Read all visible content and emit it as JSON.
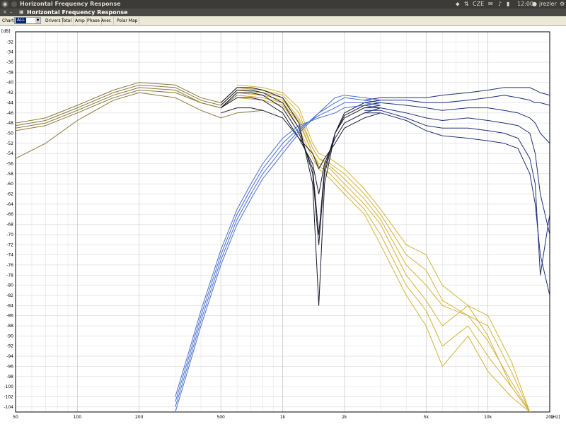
{
  "topbar": {
    "title": "Horizontal Frequency Response",
    "keyboard_layout": "CZE",
    "time": "12:00",
    "user": "jrezler"
  },
  "subbar": {
    "title": "Horizontal Frequency Response"
  },
  "toolbar": {
    "chart_label": "Chart",
    "chart_value": "ALL",
    "buttons": [
      "Drivers",
      "Total",
      "Amp",
      "Phase",
      "Aver.",
      "Polar Map"
    ]
  },
  "chart_data": {
    "type": "line",
    "ylabel": "[dB]",
    "xlabel": "[Hz]",
    "x_scale": "log",
    "xlim": [
      50,
      20000
    ],
    "ylim": [
      -105,
      -30
    ],
    "grid": true,
    "x_tick_labels": [
      {
        "value": 50,
        "label": "50"
      },
      {
        "value": 100,
        "label": "100"
      },
      {
        "value": 200,
        "label": "200"
      },
      {
        "value": 500,
        "label": "500"
      },
      {
        "value": 1000,
        "label": "1k"
      },
      {
        "value": 2000,
        "label": "2k"
      },
      {
        "value": 5000,
        "label": "5k"
      },
      {
        "value": 10000,
        "label": "10k"
      },
      {
        "value": 20000,
        "label": "20k"
      }
    ],
    "y_ticks": [
      -32,
      -34,
      -36,
      -38,
      -40,
      -42,
      -44,
      -46,
      -48,
      -50,
      -52,
      -54,
      -56,
      -58,
      -60,
      -62,
      -64,
      -66,
      -68,
      -70,
      -72,
      -74,
      -76,
      -78,
      -80,
      -82,
      -84,
      -86,
      -88,
      -90,
      -92,
      -94,
      -96,
      -98,
      -100,
      -102,
      -104
    ],
    "groups": [
      {
        "color": "#8b7a3c",
        "series": [
          {
            "x": [
              50,
              70,
              100,
              150,
              200,
              300,
              400,
              500,
              600,
              800
            ],
            "y": [
              -48,
              -47,
              -44.5,
              -41.5,
              -40,
              -40.5,
              -43,
              -44,
              -41,
              -41.5
            ]
          },
          {
            "x": [
              50,
              70,
              100,
              150,
              200,
              300,
              400,
              500,
              600,
              800
            ],
            "y": [
              -48.5,
              -47.5,
              -45,
              -42,
              -40.5,
              -41,
              -43.5,
              -44.5,
              -41.5,
              -42
            ]
          },
          {
            "x": [
              50,
              70,
              100,
              150,
              200,
              300,
              400,
              500,
              600,
              800
            ],
            "y": [
              -49,
              -48,
              -45.5,
              -42.5,
              -41,
              -41.5,
              -44,
              -45,
              -42,
              -42.5
            ]
          },
          {
            "x": [
              50,
              70,
              100,
              150,
              200,
              300,
              400,
              500,
              600,
              800
            ],
            "y": [
              -49.5,
              -48.5,
              -46,
              -43,
              -41.5,
              -42,
              -44,
              -45,
              -42.5,
              -43
            ]
          },
          {
            "x": [
              50,
              70,
              100,
              150,
              200,
              300,
              400,
              500,
              600,
              800
            ],
            "y": [
              -55,
              -52,
              -47.5,
              -43.5,
              -42,
              -43,
              -45.5,
              -47,
              -46,
              -45.5
            ]
          }
        ]
      },
      {
        "color": "#d4b13a",
        "series": [
          {
            "x": [
              600,
              800,
              1000,
              1200,
              1400,
              1500,
              1700,
              2000,
              2500,
              3000,
              4000,
              5000,
              6000,
              8000,
              10000,
              13000,
              16000
            ],
            "y": [
              -40.5,
              -41,
              -42,
              -45,
              -52,
              -54,
              -55,
              -57,
              -61,
              -65,
              -72,
              -74,
              -80,
              -84,
              -86,
              -95,
              -105
            ]
          },
          {
            "x": [
              600,
              800,
              1000,
              1200,
              1400,
              1500,
              1700,
              2000,
              2500,
              3000,
              4000,
              5000,
              6000,
              8000,
              10000,
              13000,
              16000
            ],
            "y": [
              -41,
              -41.5,
              -42.5,
              -46,
              -53,
              -55,
              -56,
              -58,
              -62,
              -66,
              -74,
              -77,
              -83,
              -86,
              -88,
              -97,
              -105
            ]
          },
          {
            "x": [
              600,
              800,
              1000,
              1200,
              1400,
              1500,
              1700,
              2000,
              2500,
              3000,
              4000,
              5000,
              6000,
              8000,
              10000,
              13000,
              16000
            ],
            "y": [
              -41.5,
              -42,
              -43,
              -47,
              -53,
              -55,
              -56.5,
              -59,
              -63,
              -67,
              -76,
              -80,
              -84,
              -86,
              -91,
              -99,
              -105
            ]
          },
          {
            "x": [
              600,
              800,
              1000,
              1200,
              1400,
              1500,
              1700,
              2000,
              2500,
              3000,
              4000,
              5000,
              6000,
              8000,
              10000,
              13000,
              16000
            ],
            "y": [
              -42,
              -42.5,
              -43.5,
              -47.5,
              -54,
              -56,
              -57,
              -60,
              -64,
              -68,
              -78,
              -83,
              -88,
              -84,
              -90,
              -100,
              -105
            ]
          },
          {
            "x": [
              600,
              800,
              1000,
              1200,
              1400,
              1500,
              1700,
              2000,
              2500,
              3000,
              4000,
              5000,
              6000,
              8000,
              10000,
              13000,
              16000
            ],
            "y": [
              -42.5,
              -43,
              -44,
              -48,
              -54,
              -56.5,
              -58,
              -61,
              -65,
              -70,
              -80,
              -85,
              -92,
              -88,
              -94,
              -100,
              -105
            ]
          },
          {
            "x": [
              600,
              800,
              1000,
              1200,
              1400,
              1500,
              1700,
              2000,
              2500,
              3000,
              4000,
              5000,
              6000,
              8000,
              10000,
              13000,
              16000
            ],
            "y": [
              -43,
              -43.5,
              -44.5,
              -49,
              -55,
              -57,
              -59,
              -62,
              -66,
              -72,
              -82,
              -88,
              -96,
              -90,
              -97,
              -102,
              -105
            ]
          }
        ]
      },
      {
        "color": "#1a1a2e",
        "series": [
          {
            "x": [
              500,
              600,
              700,
              800,
              1000,
              1200,
              1400,
              1500,
              1600,
              1800,
              2000,
              2500,
              3000
            ],
            "y": [
              -44,
              -41,
              -41,
              -41.5,
              -43,
              -48,
              -60,
              -84,
              -60,
              -50,
              -46,
              -44,
              -43.5
            ]
          },
          {
            "x": [
              500,
              600,
              700,
              800,
              1000,
              1200,
              1400,
              1500,
              1600,
              1800,
              2000,
              2500,
              3000
            ],
            "y": [
              -44.5,
              -41.5,
              -41.5,
              -42,
              -44,
              -49,
              -58,
              -72,
              -58,
              -50,
              -46.5,
              -44.5,
              -44
            ]
          },
          {
            "x": [
              500,
              600,
              700,
              800,
              1000,
              1200,
              1400,
              1500,
              1600,
              1800,
              2000,
              2500,
              3000
            ],
            "y": [
              -45,
              -42,
              -42,
              -42.5,
              -45,
              -50,
              -57,
              -70,
              -57,
              -50,
              -47,
              -45,
              -44.5
            ]
          },
          {
            "x": [
              500,
              600,
              700,
              800,
              1000,
              1200,
              1400,
              1500,
              1600,
              1800,
              2000,
              2500,
              3000
            ],
            "y": [
              -45,
              -43,
              -43,
              -43.5,
              -46,
              -51,
              -56,
              -62,
              -56,
              -51,
              -48,
              -46,
              -45
            ]
          },
          {
            "x": [
              500,
              600,
              700,
              800,
              1000,
              1200,
              1400,
              1500,
              1600,
              1800,
              2000,
              2500,
              3000
            ],
            "y": [
              -46,
              -45,
              -45,
              -45.5,
              -47,
              -51,
              -54,
              -57,
              -55,
              -52,
              -49,
              -47,
              -46
            ]
          }
        ]
      },
      {
        "color": "#4a6fd4",
        "series": [
          {
            "x": [
              300,
              350,
              400,
              500,
              600,
              700,
              800,
              1000,
              1200,
              1500,
              1800,
              2000,
              2500,
              3000
            ],
            "y": [
              -105,
              -96,
              -88,
              -76,
              -68,
              -63,
              -59,
              -54,
              -50,
              -46,
              -43,
              -42.5,
              -43,
              -43.5
            ]
          },
          {
            "x": [
              300,
              350,
              400,
              500,
              600,
              700,
              800,
              1000,
              1200,
              1500,
              1800,
              2000,
              2500,
              3000
            ],
            "y": [
              -104,
              -95,
              -87,
              -75,
              -67,
              -62,
              -58,
              -53,
              -49.5,
              -46,
              -44,
              -43,
              -43.5,
              -44
            ]
          },
          {
            "x": [
              300,
              350,
              400,
              500,
              600,
              700,
              800,
              1000,
              1200,
              1500,
              1800,
              2000,
              2500,
              3000
            ],
            "y": [
              -103,
              -94,
              -86,
              -74,
              -66,
              -61,
              -57,
              -52,
              -49,
              -46.5,
              -45,
              -44,
              -44,
              -44.5
            ]
          },
          {
            "x": [
              300,
              350,
              400,
              500,
              600,
              700,
              800,
              1000,
              1200,
              1500,
              1800,
              2000,
              2500,
              3000
            ],
            "y": [
              -102,
              -93,
              -85,
              -73,
              -65,
              -60,
              -56,
              -51,
              -48.5,
              -47,
              -46,
              -45,
              -44.5,
              -45
            ]
          }
        ]
      },
      {
        "color": "#1f2f7a",
        "series": [
          {
            "x": [
              2500,
              3000,
              4000,
              5000,
              6000,
              8000,
              10000,
              12000,
              14000,
              16000,
              17000,
              18000,
              20000
            ],
            "y": [
              -43.5,
              -43,
              -43,
              -43,
              -42.5,
              -42,
              -41.5,
              -41,
              -41,
              -41,
              -41.5,
              -42,
              -42.5
            ]
          },
          {
            "x": [
              2500,
              3000,
              4000,
              5000,
              6000,
              8000,
              10000,
              12000,
              14000,
              16000,
              17000,
              18000,
              20000
            ],
            "y": [
              -44,
              -43.5,
              -43.5,
              -44,
              -44,
              -43.5,
              -43,
              -42.5,
              -43,
              -43.5,
              -44,
              -44,
              -44.5
            ]
          },
          {
            "x": [
              2500,
              3000,
              4000,
              5000,
              6000,
              8000,
              10000,
              12000,
              14000,
              16000,
              17000,
              18000,
              20000
            ],
            "y": [
              -44.5,
              -44,
              -44.5,
              -45,
              -45.5,
              -45,
              -45,
              -45.5,
              -46,
              -47,
              -48,
              -50,
              -52
            ]
          },
          {
            "x": [
              2500,
              3000,
              4000,
              5000,
              6000,
              8000,
              10000,
              12000,
              14000,
              16000,
              17000,
              18000,
              20000
            ],
            "y": [
              -45,
              -45,
              -46,
              -47,
              -47.5,
              -47,
              -47.5,
              -48,
              -48.5,
              -50,
              -54,
              -62,
              -70
            ]
          },
          {
            "x": [
              2500,
              3000,
              4000,
              5000,
              6000,
              8000,
              10000,
              12000,
              14000,
              16000,
              17000,
              18000,
              20000
            ],
            "y": [
              -45.5,
              -45.5,
              -47,
              -48.5,
              -49,
              -49,
              -49.5,
              -50,
              -51,
              -55,
              -60,
              -78,
              -66
            ]
          },
          {
            "x": [
              2500,
              3000,
              4000,
              5000,
              6000,
              8000,
              10000,
              12000,
              14000,
              16000,
              17000,
              18000,
              20000
            ],
            "y": [
              -46,
              -46,
              -47.5,
              -49.5,
              -50.5,
              -51,
              -51.5,
              -52,
              -53,
              -58,
              -64,
              -74,
              -82
            ]
          }
        ]
      }
    ]
  }
}
